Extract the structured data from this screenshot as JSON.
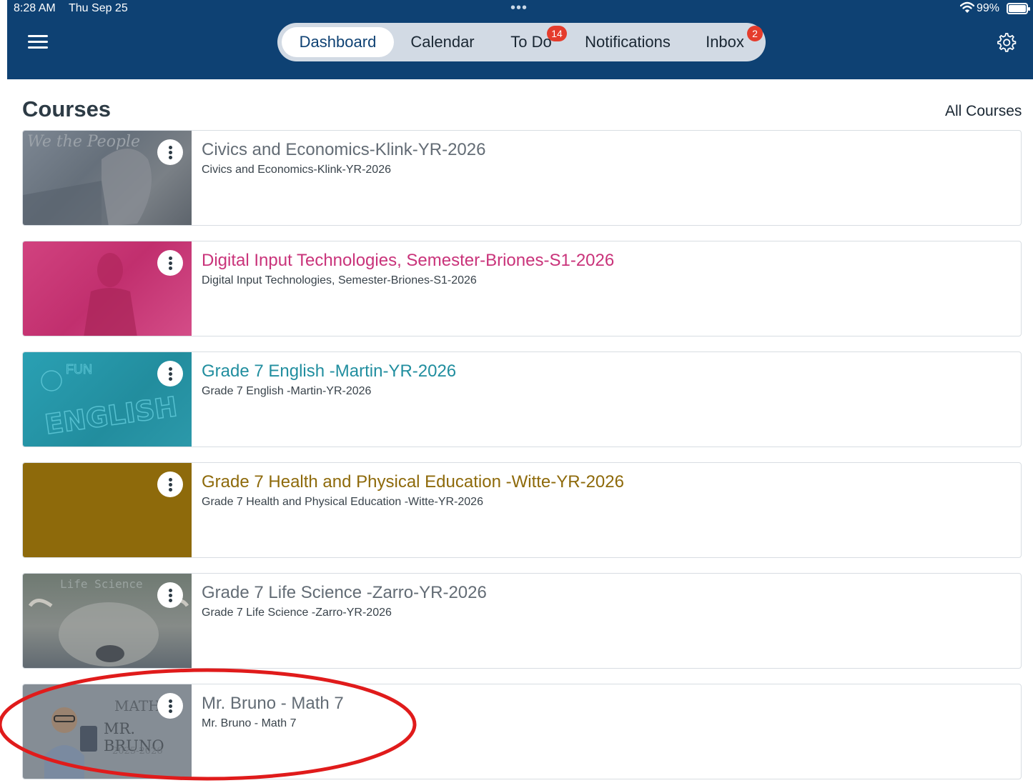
{
  "status_bar": {
    "time": "8:28 AM",
    "date": "Thu Sep 25",
    "battery": "99%",
    "battery_level": 0.99
  },
  "nav": {
    "tabs": [
      {
        "label": "Dashboard",
        "active": true
      },
      {
        "label": "Calendar"
      },
      {
        "label": "To Do",
        "badge": "14"
      },
      {
        "label": "Notifications"
      },
      {
        "label": "Inbox",
        "badge": "2"
      }
    ],
    "menu_icon": "hamburger-icon",
    "settings_icon": "gear-icon"
  },
  "colors": {
    "header": "#0e4173",
    "badge": "#e53c2c",
    "highlight": "#e01b1b"
  },
  "courses": {
    "title": "Courses",
    "all_courses": "All Courses",
    "items": [
      {
        "title": "Civics and Economics-Klink-YR-2026",
        "subtitle": "Civics and Economics-Klink-YR-2026",
        "color": "#636c75"
      },
      {
        "title": "Digital Input Technologies, Semester-Briones-S1-2026",
        "subtitle": "Digital Input Technologies, Semester-Briones-S1-2026",
        "color": "#c9337a"
      },
      {
        "title": "Grade 7 English -Martin-YR-2026",
        "subtitle": "Grade 7 English -Martin-YR-2026",
        "color": "#218e9f"
      },
      {
        "title": "Grade 7 Health and Physical Education -Witte-YR-2026",
        "subtitle": "Grade 7 Health and Physical Education -Witte-YR-2026",
        "color": "#8e6a0b"
      },
      {
        "title": "Grade 7 Life Science -Zarro-YR-2026",
        "subtitle": "Grade 7 Life Science -Zarro-YR-2026",
        "color": "#636c75",
        "image_text": "Life Science"
      },
      {
        "title": "Mr. Bruno - Math 7",
        "subtitle": "Mr. Bruno - Math 7",
        "color": "#636c75",
        "image_text": [
          "MATH 7",
          "MR. BRUNO",
          "2025-2026"
        ]
      }
    ]
  }
}
